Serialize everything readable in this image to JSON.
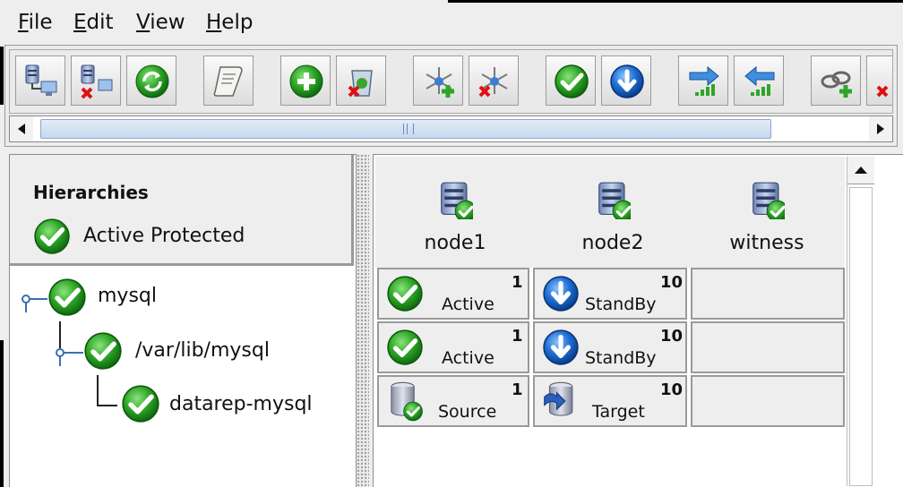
{
  "menu": {
    "file": "File",
    "edit": "Edit",
    "view": "View",
    "help": "Help",
    "file_mn": "F",
    "file_rest": "ile",
    "edit_mn": "E",
    "edit_rest": "dit",
    "view_mn": "V",
    "view_rest": "iew",
    "help_mn": "H",
    "help_rest": "elp"
  },
  "toolbar": {
    "buttons": [
      "connect-server",
      "disconnect-server",
      "refresh",
      "view-log",
      "create-resource",
      "delete-resource",
      "extend-hierarchy",
      "unextend-hierarchy",
      "in-service",
      "out-of-service",
      "create-dependency-in",
      "create-dependency-out",
      "create-dependency",
      "delete-dependency"
    ]
  },
  "hierarchies": {
    "title": "Hierarchies",
    "status": "Active Protected",
    "status_color": "#2a9d22",
    "tree": [
      {
        "label": "mysql",
        "level": 0
      },
      {
        "label": "/var/lib/mysql",
        "level": 1
      },
      {
        "label": "datarep-mysql",
        "level": 2
      }
    ]
  },
  "servers": [
    {
      "name": "node1"
    },
    {
      "name": "node2"
    },
    {
      "name": "witness"
    }
  ],
  "resource_states": [
    [
      {
        "state": "Active",
        "priority": "1",
        "icon": "check-icon"
      },
      {
        "state": "StandBy",
        "priority": "10",
        "icon": "down-arrow-icon"
      }
    ],
    [
      {
        "state": "Active",
        "priority": "1",
        "icon": "check-icon"
      },
      {
        "state": "StandBy",
        "priority": "10",
        "icon": "down-arrow-icon"
      }
    ],
    [
      {
        "state": "Source",
        "priority": "1",
        "icon": "source-disk-icon"
      },
      {
        "state": "Target",
        "priority": "10",
        "icon": "target-disk-icon"
      }
    ]
  ],
  "colors": {
    "active_green": "#2a9d22",
    "standby_blue": "#1d6fd6",
    "accent": "#c7d8ef"
  }
}
